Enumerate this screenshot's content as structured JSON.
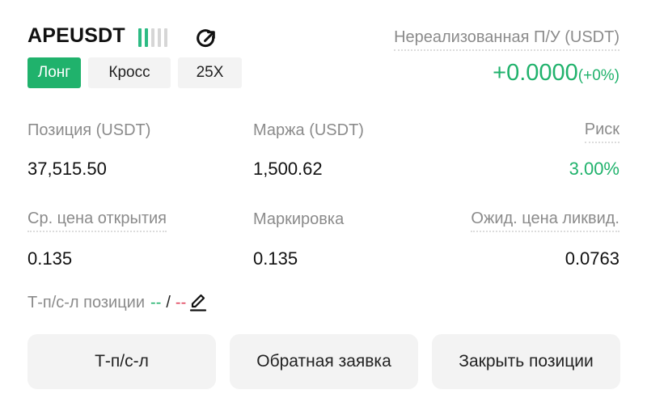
{
  "header": {
    "symbol": "APEUSDT",
    "leverage_indicator": {
      "active_bars": 2,
      "total_bars": 5,
      "color": "#2dbb84"
    },
    "share_icon": "share-arrow-icon"
  },
  "tags": {
    "side": "Лонг",
    "margin_mode": "Кросс",
    "leverage": "25X"
  },
  "pnl": {
    "label": "Нереализованная П/У (USDT)",
    "value": "+0.0000",
    "percent": "(+0%)"
  },
  "stats": {
    "position_label": "Позиция (USDT)",
    "position_value": "37,515.50",
    "margin_label": "Маржа (USDT)",
    "margin_value": "1,500.62",
    "risk_label": "Риск",
    "risk_value": "3.00%",
    "entry_label": "Ср. цена открытия",
    "entry_value": "0.135",
    "mark_label": "Маркировка",
    "mark_value": "0.135",
    "liq_label": "Ожид. цена ликвид.",
    "liq_value": "0.0763"
  },
  "tpsl": {
    "label": "Т-п/с-л позиции",
    "tp": "--",
    "separator": "/",
    "sl": "--",
    "edit_icon": "pencil-icon"
  },
  "buttons": {
    "tpsl": "Т-п/с-л",
    "reverse": "Обратная заявка",
    "close": "Закрыть позиции"
  },
  "colors": {
    "accent_green": "#20b26c",
    "loss_red": "#e0405a",
    "button_bg": "#f3f3f3"
  }
}
